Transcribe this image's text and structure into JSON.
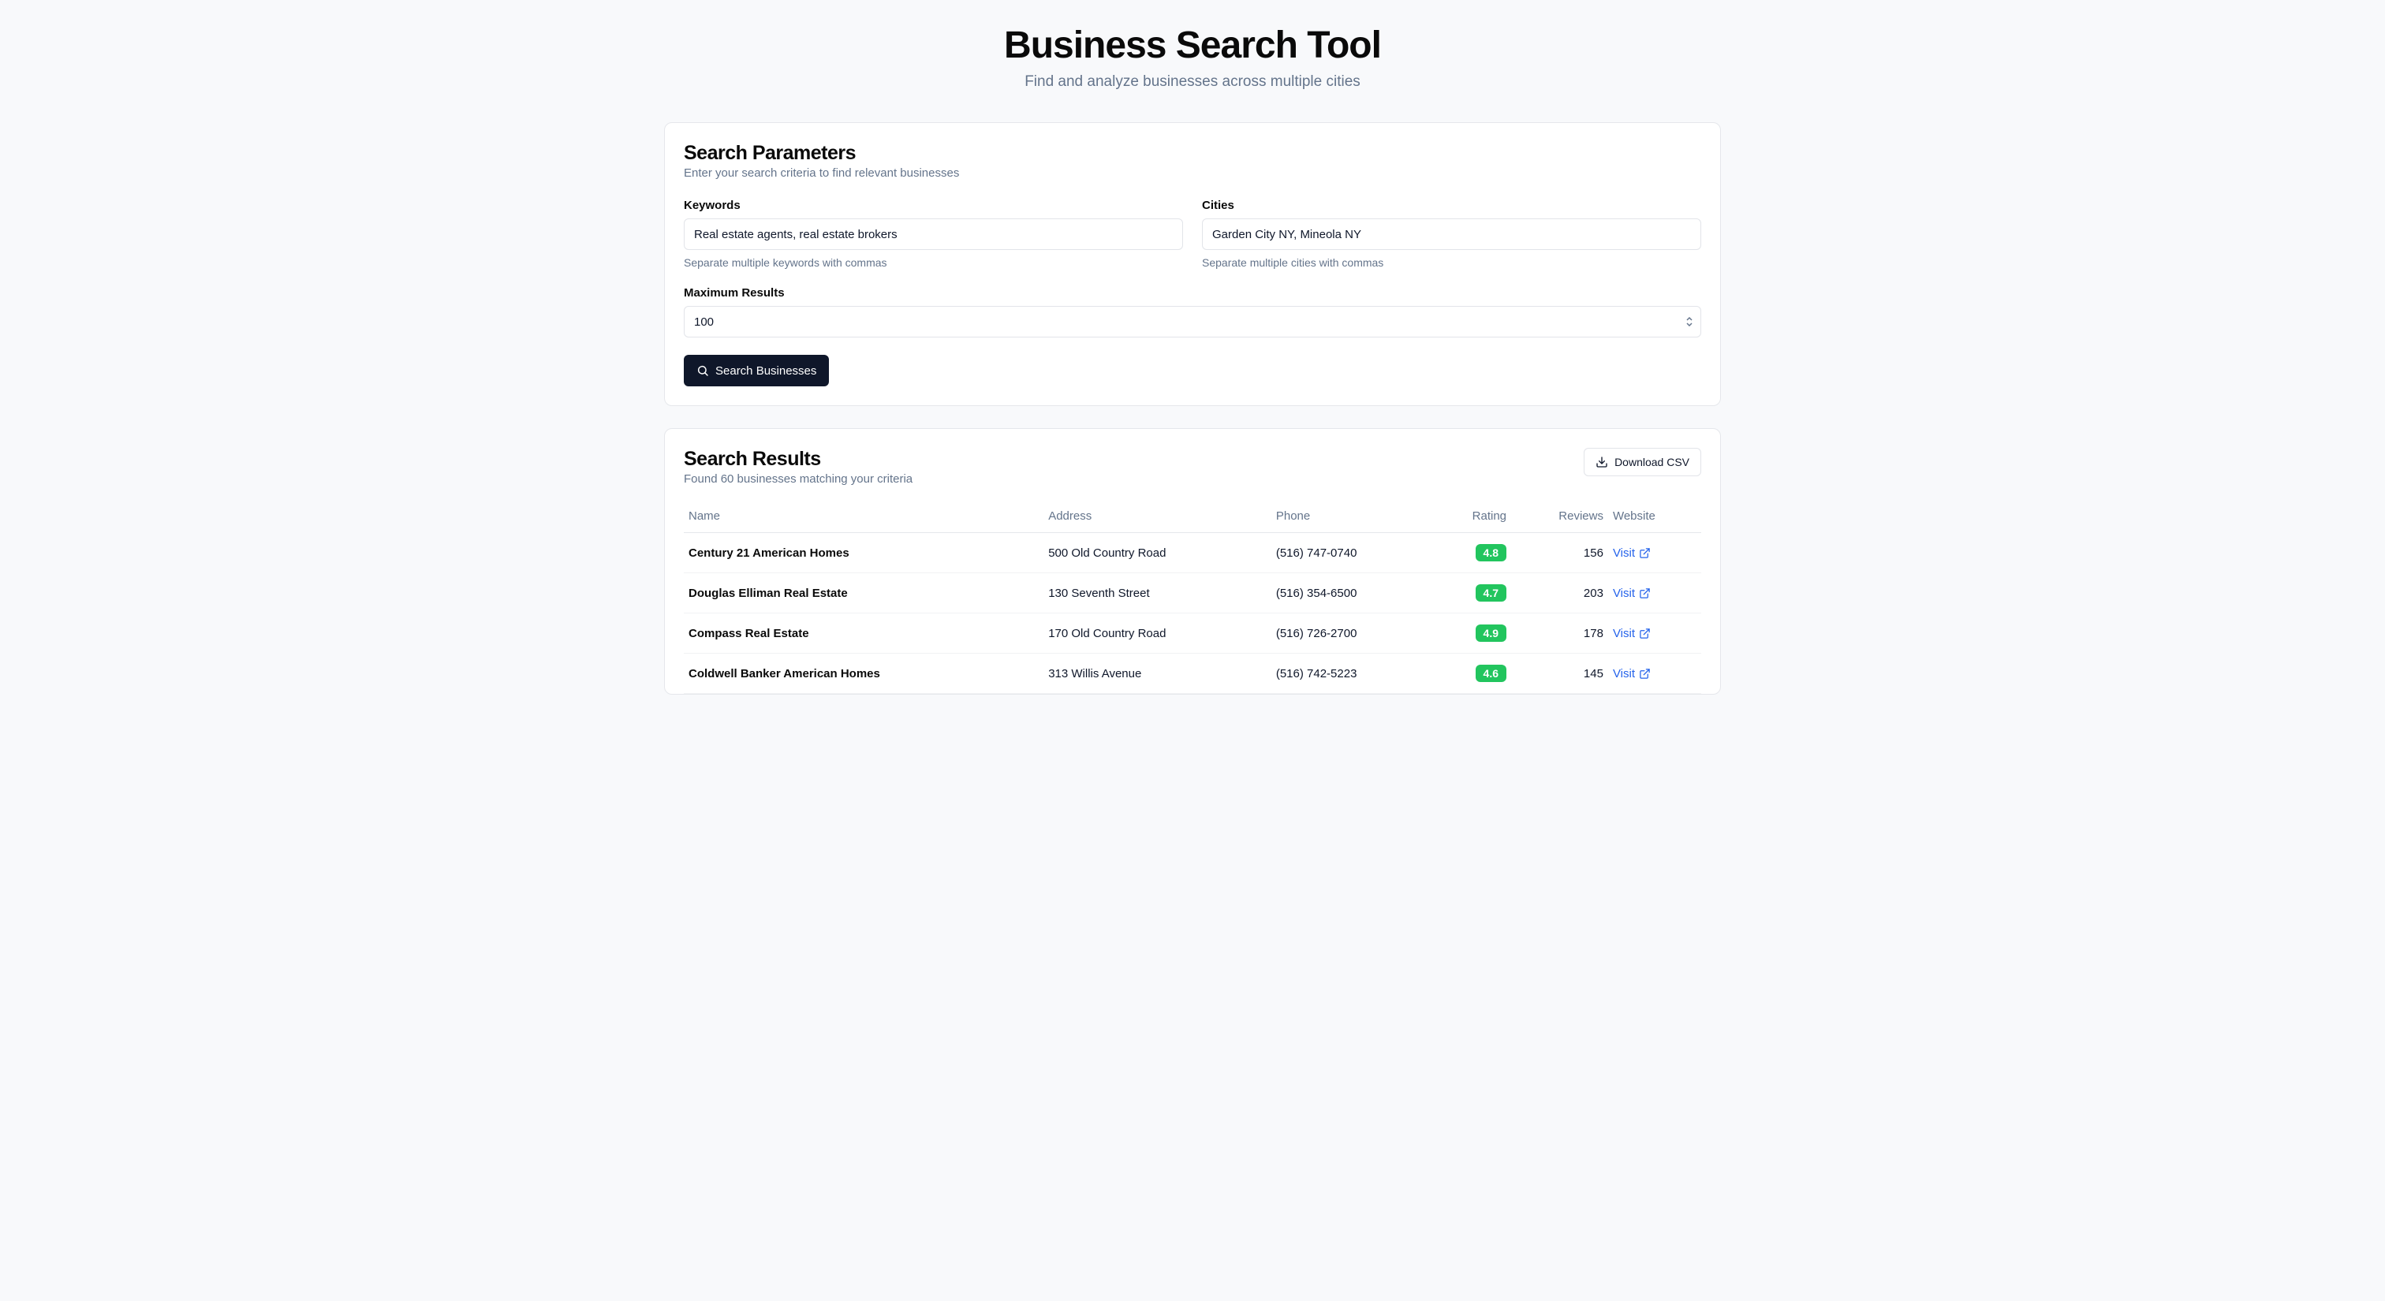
{
  "header": {
    "title": "Business Search Tool",
    "subtitle": "Find and analyze businesses across multiple cities"
  },
  "search_params": {
    "title": "Search Parameters",
    "subtitle": "Enter your search criteria to find relevant businesses",
    "keywords_label": "Keywords",
    "keywords_value": "Real estate agents, real estate brokers",
    "keywords_hint": "Separate multiple keywords with commas",
    "cities_label": "Cities",
    "cities_value": "Garden City NY, Mineola NY",
    "cities_hint": "Separate multiple cities with commas",
    "max_results_label": "Maximum Results",
    "max_results_value": "100",
    "search_button": "Search Businesses"
  },
  "results": {
    "title": "Search Results",
    "subtitle": "Found 60 businesses matching your criteria",
    "download_label": "Download CSV",
    "columns": {
      "name": "Name",
      "address": "Address",
      "phone": "Phone",
      "rating": "Rating",
      "reviews": "Reviews",
      "website": "Website"
    },
    "visit_label": "Visit",
    "rows": [
      {
        "name": "Century 21 American Homes",
        "address": "500 Old Country Road",
        "phone": "(516) 747-0740",
        "rating": "4.8",
        "reviews": "156"
      },
      {
        "name": "Douglas Elliman Real Estate",
        "address": "130 Seventh Street",
        "phone": "(516) 354-6500",
        "rating": "4.7",
        "reviews": "203"
      },
      {
        "name": "Compass Real Estate",
        "address": "170 Old Country Road",
        "phone": "(516) 726-2700",
        "rating": "4.9",
        "reviews": "178"
      },
      {
        "name": "Coldwell Banker American Homes",
        "address": "313 Willis Avenue",
        "phone": "(516) 742-5223",
        "rating": "4.6",
        "reviews": "145"
      }
    ]
  }
}
